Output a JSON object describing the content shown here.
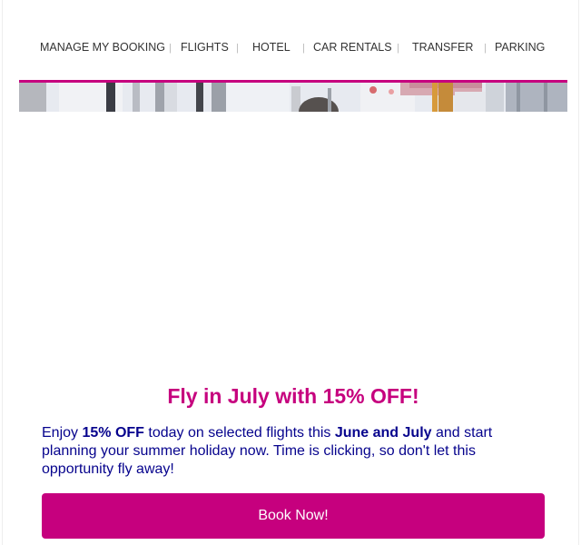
{
  "nav": {
    "items": [
      {
        "label": "MANAGE MY BOOKING"
      },
      {
        "label": "FLIGHTS"
      },
      {
        "label": "HOTEL"
      },
      {
        "label": "CAR RENTALS"
      },
      {
        "label": "TRANSFER"
      },
      {
        "label": "PARKING"
      }
    ],
    "separator": "|"
  },
  "hero": {
    "accent_color": "#c6007e"
  },
  "promo": {
    "headline": "Fly in July with 15% OFF!",
    "body": {
      "part1": "Enjoy ",
      "bold1": "15% OFF",
      "part2": " today on selected flights this ",
      "bold2": "June and July",
      "part3": " and start planning your summer holiday now. Time is clicking, so don't let this opportunity fly away!"
    },
    "cta_label": "Book Now!",
    "headline_color": "#c6007e",
    "text_color": "#06038d",
    "button_color": "#c6007e"
  }
}
